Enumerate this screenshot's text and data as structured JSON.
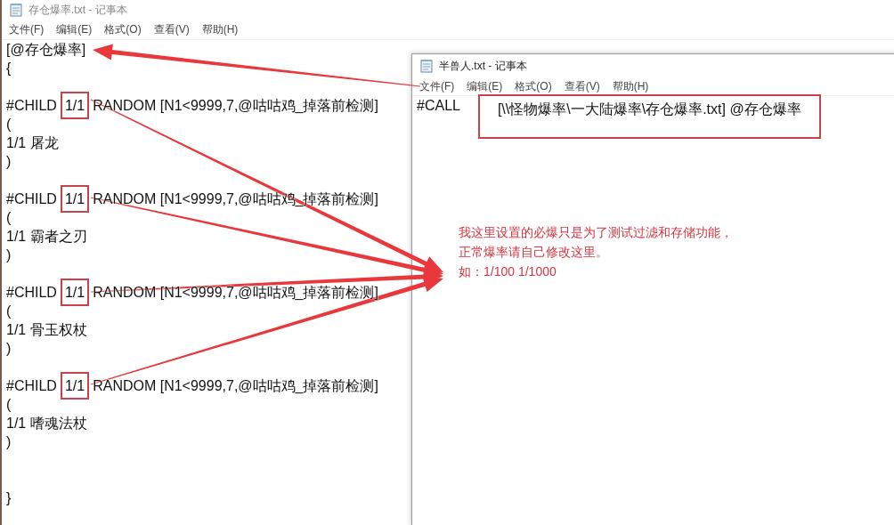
{
  "back_window": {
    "title": "存仓爆率.txt - 记事本",
    "menu": [
      "文件(F)",
      "编辑(E)",
      "格式(O)",
      "查看(V)",
      "帮助(H)"
    ],
    "lines": [
      {
        "kind": "plain",
        "text": "[@存仓爆率]"
      },
      {
        "kind": "plain",
        "text": "{"
      },
      {
        "kind": "blank"
      },
      {
        "kind": "boxed",
        "before": "#CHILD",
        "boxed": "1/1",
        "after": "RANDOM [N1<9999,7,@咕咕鸡_掉落前检测]"
      },
      {
        "kind": "plain",
        "text": "("
      },
      {
        "kind": "plain",
        "text": "1/1 屠龙"
      },
      {
        "kind": "plain",
        "text": ")"
      },
      {
        "kind": "blank"
      },
      {
        "kind": "boxed",
        "before": "#CHILD",
        "boxed": "1/1",
        "after": "RANDOM [N1<9999,7,@咕咕鸡_掉落前检测]"
      },
      {
        "kind": "plain",
        "text": "("
      },
      {
        "kind": "plain",
        "text": "1/1 霸者之刃"
      },
      {
        "kind": "plain",
        "text": ")"
      },
      {
        "kind": "blank"
      },
      {
        "kind": "boxed",
        "before": "#CHILD",
        "boxed": "1/1",
        "after": "RANDOM [N1<9999,7,@咕咕鸡_掉落前检测]"
      },
      {
        "kind": "plain",
        "text": "("
      },
      {
        "kind": "plain",
        "text": "1/1 骨玉权杖"
      },
      {
        "kind": "plain",
        "text": ")"
      },
      {
        "kind": "blank"
      },
      {
        "kind": "boxed",
        "before": "#CHILD",
        "boxed": "1/1",
        "after": "RANDOM [N1<9999,7,@咕咕鸡_掉落前检测]"
      },
      {
        "kind": "plain",
        "text": "("
      },
      {
        "kind": "plain",
        "text": "1/1 嗜魂法杖"
      },
      {
        "kind": "plain",
        "text": ")"
      },
      {
        "kind": "blank"
      },
      {
        "kind": "blank"
      },
      {
        "kind": "plain",
        "text": "}"
      }
    ]
  },
  "front_window": {
    "title": "半兽人.txt - 记事本",
    "menu": [
      "文件(F)",
      "编辑(E)",
      "格式(O)",
      "查看(V)",
      "帮助(H)"
    ],
    "lines": [
      {
        "kind": "boxed",
        "before": "#CALL",
        "boxed": "[\\\\怪物爆率\\一大陆爆率\\存仓爆率.txt] @存仓爆率"
      }
    ]
  },
  "note": [
    "我这里设置的必爆只是为了测试过滤和存储功能，",
    "正常爆率请自己修改这里。",
    "如：1/100 1/1000"
  ]
}
